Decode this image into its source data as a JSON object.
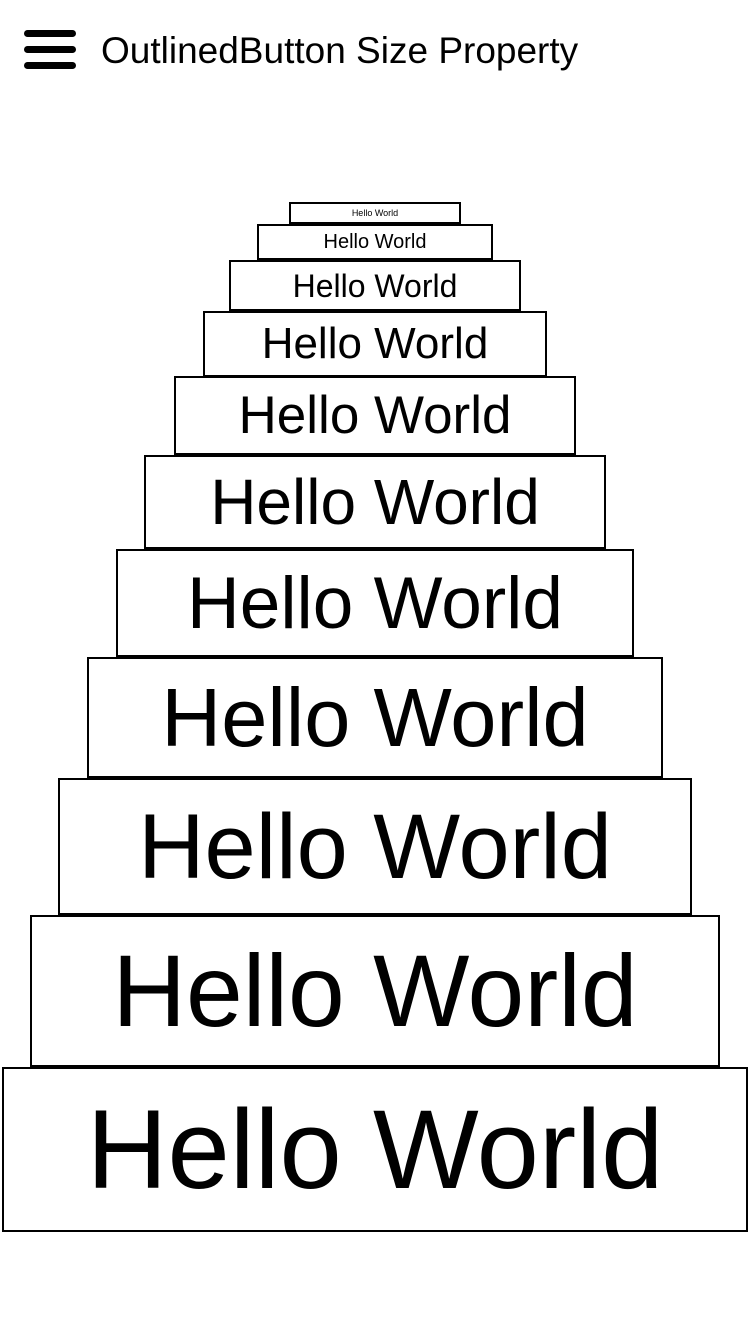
{
  "app_bar": {
    "title": "OutlinedButton Size Property",
    "menu_icon": "menu-icon"
  },
  "buttons": [
    {
      "label": "Hello World"
    },
    {
      "label": "Hello World"
    },
    {
      "label": "Hello World"
    },
    {
      "label": "Hello World"
    },
    {
      "label": "Hello World"
    },
    {
      "label": "Hello World"
    },
    {
      "label": "Hello World"
    },
    {
      "label": "Hello World"
    },
    {
      "label": "Hello World"
    },
    {
      "label": "Hello World"
    },
    {
      "label": "Hello World"
    }
  ],
  "colors": {
    "background": "#ffffff",
    "foreground": "#000000"
  }
}
